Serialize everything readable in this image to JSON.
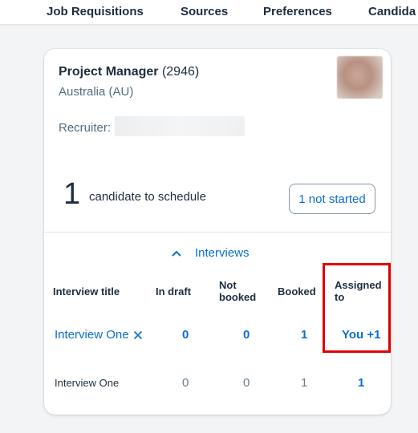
{
  "nav": {
    "items": [
      "Job Requisitions",
      "Sources",
      "Preferences",
      "Candida"
    ]
  },
  "card": {
    "job_name": "Project Manager",
    "job_id": "(2946)",
    "location": "Australia (AU)",
    "recruiter_label": "Recruiter:",
    "candidate_count": "1",
    "candidate_text": "candidate to schedule",
    "not_started_label": "1 not started",
    "interviews_label": "Interviews"
  },
  "table": {
    "headers": {
      "title": "Interview title",
      "in_draft": "In draft",
      "not_booked_1": "Not",
      "not_booked_2": "booked",
      "booked": "Booked",
      "assigned_1": "Assigned",
      "assigned_2": "to"
    },
    "rows": [
      {
        "title": "Interview One",
        "in_draft": "0",
        "not_booked": "0",
        "booked": "1",
        "assigned": "You +1"
      },
      {
        "title": "Interview One",
        "in_draft": "0",
        "not_booked": "0",
        "booked": "1",
        "assigned": "1"
      }
    ]
  },
  "colors": {
    "link": "#0a6ed1",
    "highlight": "#e00000"
  }
}
